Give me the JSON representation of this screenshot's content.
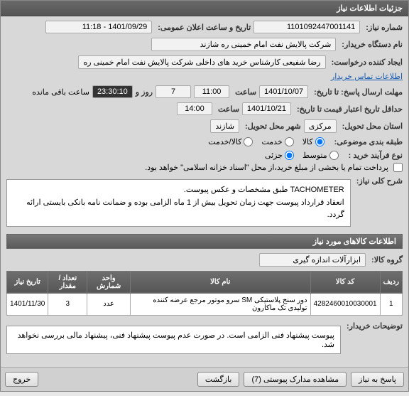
{
  "panel": {
    "title": "جزئیات اطلاعات نیاز"
  },
  "fields": {
    "need_no_label": "شماره نیاز:",
    "need_no": "1101092447001141",
    "announce_label": "تاریخ و ساعت اعلان عمومی:",
    "announce_val": "1401/09/29 - 11:18",
    "org_label": "نام دستگاه خریدار:",
    "org_val": "شرکت پالایش نفت امام خمینی ره شازند",
    "creator_label": "ایجاد کننده درخواست:",
    "creator_val": "رضا شفیعی کارشناس خرید های داخلی شرکت پالایش نفت امام خمینی ره",
    "contact_link": "اطلاعات تماس خریدار",
    "deadline_label": "حداقل تاریخ اعتبار قیمت تا تاریخ:",
    "deadline_date": "1401/10/07",
    "time_label": "ساعت",
    "deadline_time": "11:00",
    "days": "7",
    "days_suffix": "روز و",
    "countdown": "23:30:10",
    "remaining": "ساعت باقی مانده",
    "reply_deadline_date": "1401/10/21",
    "reply_deadline_time": "14:00",
    "reply_deadline_label": "مهلت ارسال پاسخ: تا تاریخ:",
    "loc_label": "استان محل تحویل:",
    "loc_val": "مرکزی",
    "city_label": "شهر محل تحویل:",
    "city_val": "شازند",
    "class_label": "طبقه بندی موضوعی:",
    "class_goods": "کالا",
    "class_service": "خدمت",
    "class_both": "کالا/خدمت",
    "buy_type_label": "نوع فرآیند خرید :",
    "buy_type_mid": "متوسط",
    "buy_type_small": "جزئی",
    "pay_note": "پرداخت تمام یا بخشی از مبلغ خرید،از محل \"اسناد خزانه اسلامی\" خواهد بود.",
    "need_desc_label": "شرح کلی نیاز:",
    "need_desc_line1": "TACHOMETER طبق مشخصات و عکس پیوست.",
    "need_desc_line2": "انعقاد قرارداد پیوست جهت زمان تحویل بیش از 1 ماه الزامی بوده و ضمانت نامه بانکی بایستی ارائه گردد.",
    "buyer_note_label": "توضیحات خریدار:",
    "buyer_note": "پیوست پیشنهاد فنی الزامی است. در صورت عدم پیوست پیشنهاد فنی، پیشنهاد مالی بررسی نخواهد شد."
  },
  "items_section": {
    "title": "اطلاعات کالاهای مورد نیاز",
    "group_label": "گروه کالا:",
    "group_val": "ابزارآلات اندازه گیری"
  },
  "table": {
    "headers": {
      "row": "ردیف",
      "code": "کد کالا",
      "name": "نام کالا",
      "unit": "واحد شمارش",
      "qty": "تعداد / مقدار",
      "date": "تاریخ نیاز"
    },
    "rows": [
      {
        "row": "1",
        "code": "4282460010030001",
        "name": "دور سنج پلاستیکی SM سرو موتور مرجع عرضه کننده تولیدی تک ماکارون",
        "unit": "عدد",
        "qty": "3",
        "date": "1401/11/30"
      }
    ]
  },
  "buttons": {
    "reply": "پاسخ به نیاز",
    "attachments": "مشاهده مدارک پیوستی (7)",
    "back": "بازگشت",
    "exit": "خروج"
  }
}
